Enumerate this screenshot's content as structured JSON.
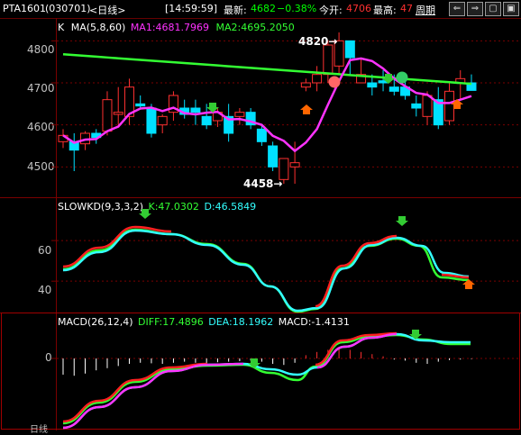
{
  "header": {
    "symbol": "PTA1601",
    "code": "(030701)",
    "period_tag": "<日线>",
    "time": "[14:59:59]",
    "last_label": "最新:",
    "last_value": "4682",
    "change_pct": "−0.38%",
    "open_label": "今开:",
    "open_value": "4706",
    "high_label": "最高:",
    "high_value": "47",
    "period_link": "周期"
  },
  "nav": {
    "prev": "⇐",
    "next": "⇒",
    "zoom": "▢",
    "close": "▣"
  },
  "colors": {
    "up": "#ff3030",
    "down": "#00e0ff",
    "ma1": "#ff33ff",
    "ma2": "#33ff33",
    "k": "#ff2020",
    "d": "#33ffff",
    "dea": "#33ff33",
    "grid": "#7a0000"
  },
  "main": {
    "title_k": "K",
    "title_ma": "MA(5,8,60)",
    "ma1_label": "MA1:4681.7969",
    "ma2_label": "MA2:4695.2050",
    "y_labels": [
      "4800",
      "4700",
      "4600",
      "4500"
    ],
    "high_annot": "4820",
    "low_annot": "4458"
  },
  "kd": {
    "title": "SLOWKD(9,3,3,2)",
    "k_label": "K:47.0302",
    "d_label": "D:46.5849",
    "y_labels": [
      "60",
      "40"
    ]
  },
  "macd": {
    "title": "MACD(26,12,4)",
    "diff_label": "DIFF:17.4896",
    "dea_label": "DEA:18.1962",
    "macd_label": "MACD:-1.4131",
    "y_labels": [
      "0"
    ],
    "bottom_tag": "日线"
  },
  "chart_data": [
    {
      "type": "candlestick",
      "title": "K MA(5,8,60)",
      "ylim": [
        4430,
        4850
      ],
      "ohlc": [
        [
          4560,
          4590,
          4545,
          4575
        ],
        [
          4560,
          4580,
          4490,
          4540
        ],
        [
          4555,
          4585,
          4540,
          4580
        ],
        [
          4580,
          4590,
          4555,
          4570
        ],
        [
          4585,
          4680,
          4575,
          4660
        ],
        [
          4625,
          4690,
          4600,
          4630
        ],
        [
          4620,
          4710,
          4600,
          4690
        ],
        [
          4650,
          4670,
          4640,
          4645
        ],
        [
          4640,
          4650,
          4570,
          4580
        ],
        [
          4600,
          4625,
          4580,
          4620
        ],
        [
          4630,
          4680,
          4610,
          4670
        ],
        [
          4640,
          4660,
          4615,
          4625
        ],
        [
          4640,
          4660,
          4600,
          4630
        ],
        [
          4620,
          4650,
          4590,
          4600
        ],
        [
          4610,
          4640,
          4595,
          4630
        ],
        [
          4620,
          4650,
          4560,
          4580
        ],
        [
          4620,
          4640,
          4600,
          4630
        ],
        [
          4630,
          4640,
          4590,
          4600
        ],
        [
          4590,
          4600,
          4550,
          4560
        ],
        [
          4550,
          4560,
          4490,
          4500
        ],
        [
          4470,
          4520,
          4460,
          4520
        ],
        [
          4500,
          4560,
          4460,
          4510
        ],
        [
          4690,
          4710,
          4680,
          4700
        ],
        [
          4700,
          4740,
          4680,
          4720
        ],
        [
          4720,
          4800,
          4700,
          4790
        ],
        [
          4740,
          4820,
          4720,
          4800
        ],
        [
          4800,
          4790,
          4720,
          4760
        ],
        [
          4700,
          4760,
          4700,
          4720
        ],
        [
          4700,
          4720,
          4670,
          4690
        ],
        [
          4705,
          4730,
          4680,
          4700
        ],
        [
          4690,
          4720,
          4670,
          4680
        ],
        [
          4690,
          4710,
          4660,
          4670
        ],
        [
          4650,
          4670,
          4620,
          4640
        ],
        [
          4620,
          4680,
          4600,
          4670
        ],
        [
          4660,
          4690,
          4590,
          4600
        ],
        [
          4610,
          4700,
          4600,
          4680
        ],
        [
          4700,
          4730,
          4660,
          4710
        ],
        [
          4700,
          4720,
          4690,
          4682
        ]
      ],
      "annotations": [
        "4820",
        "4458"
      ]
    },
    {
      "type": "line",
      "title": "SLOWKD(9,3,3,2)",
      "series": [
        {
          "name": "K",
          "values": [
            47.0302
          ]
        },
        {
          "name": "D",
          "values": [
            46.5849
          ]
        }
      ]
    },
    {
      "type": "bar",
      "title": "MACD(26,12,4)",
      "series": [
        {
          "name": "DIFF",
          "values": [
            17.4896
          ]
        },
        {
          "name": "DEA",
          "values": [
            18.1962
          ]
        },
        {
          "name": "MACD",
          "values": [
            -1.4131
          ]
        }
      ]
    }
  ]
}
